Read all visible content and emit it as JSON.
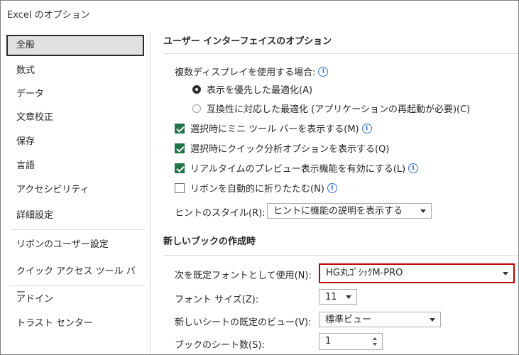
{
  "window": {
    "title": "Excel のオプション"
  },
  "sidebar": {
    "items": [
      {
        "label": "全般",
        "selected": true
      },
      {
        "label": "数式"
      },
      {
        "label": "データ"
      },
      {
        "label": "文章校正"
      },
      {
        "label": "保存"
      },
      {
        "label": "言語"
      },
      {
        "label": "アクセシビリティ"
      },
      {
        "label": "詳細設定"
      },
      {
        "label": "リボンのユーザー設定"
      },
      {
        "label": "クイック アクセス ツール バー"
      },
      {
        "label": "アドイン"
      },
      {
        "label": "トラスト センター"
      }
    ]
  },
  "ui_section": {
    "heading": "ユーザー インターフェイスのオプション",
    "multi_display_label": "複数ディスプレイを使用する場合:",
    "radio_optimize_display": "表示を優先した最適化(A)",
    "radio_optimize_compat": "互換性に対応した最適化 (アプリケーションの再起動が必要)(C)",
    "mini_toolbar_label": "選択時にミニ ツール バーを表示する(M)",
    "mini_toolbar_checked": true,
    "quick_analysis_label": "選択時にクイック分析オプションを表示する(Q)",
    "quick_analysis_checked": true,
    "live_preview_label": "リアルタイムのプレビュー表示機能を有効にする(L)",
    "live_preview_checked": true,
    "collapse_ribbon_label": "リボンを自動的に折りたたむ(N)",
    "collapse_ribbon_checked": false,
    "tooltip_style_label": "ヒントのスタイル(R):",
    "tooltip_style_value": "ヒントに機能の説明を表示する"
  },
  "new_book_section": {
    "heading": "新しいブックの作成時",
    "default_font_label": "次を既定フォントとして使用(N):",
    "default_font_value": "HG丸ｺﾞｼｯｸM-PRO",
    "font_size_label": "フォント サイズ(Z):",
    "font_size_value": "11",
    "default_view_label": "新しいシートの既定のビュー(V):",
    "default_view_value": "標準ビュー",
    "sheet_count_label": "ブックのシート数(S):",
    "sheet_count_value": "1"
  },
  "colors": {
    "accent_green": "#217346",
    "info_blue": "#2b6fd6",
    "highlight_red": "#c00000"
  },
  "icons": {
    "info": "i"
  }
}
